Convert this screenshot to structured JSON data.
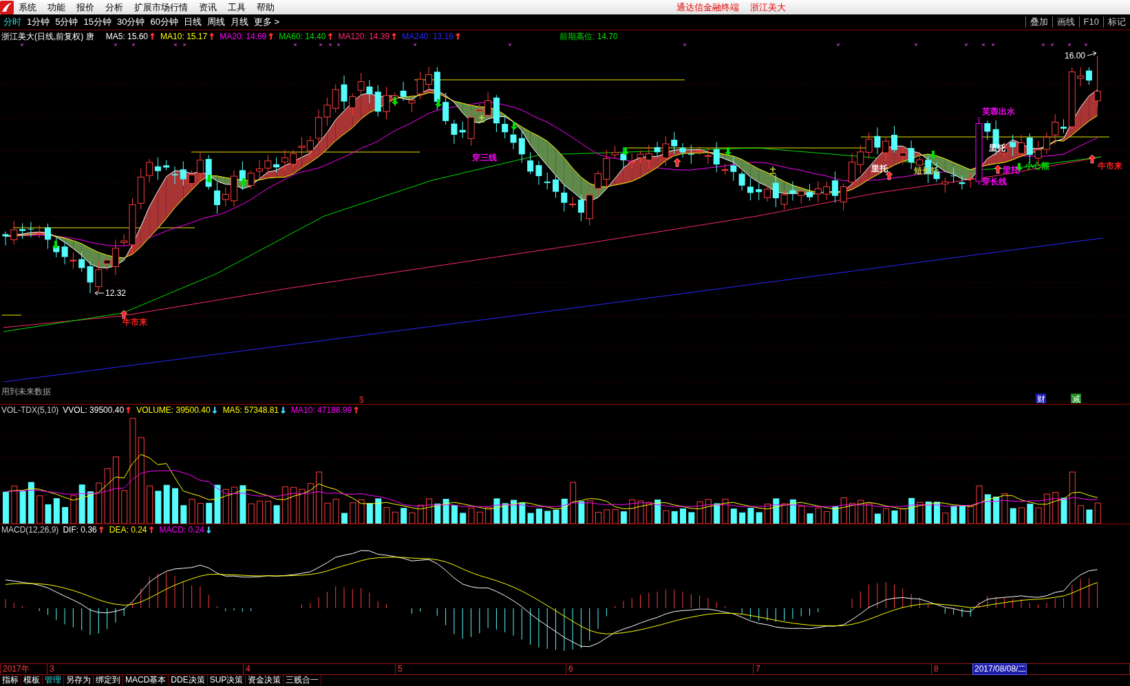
{
  "menu_bar": {
    "items": [
      "系统",
      "功能",
      "报价",
      "分析",
      "扩展市场行情",
      "资讯",
      "工具",
      "帮助"
    ],
    "titles": [
      "通达信金融终端",
      "浙江美大"
    ]
  },
  "period_bar": {
    "tabs": [
      {
        "label": "分时",
        "highlighted": true
      },
      {
        "label": "1分钟",
        "highlighted": false
      },
      {
        "label": "5分钟",
        "highlighted": false
      },
      {
        "label": "15分钟",
        "highlighted": false
      },
      {
        "label": "30分钟",
        "highlighted": false
      },
      {
        "label": "60分钟",
        "highlighted": false
      },
      {
        "label": "日线",
        "highlighted": false
      },
      {
        "label": "周线",
        "highlighted": false
      },
      {
        "label": "月线",
        "highlighted": false
      },
      {
        "label": "更多 >",
        "highlighted": false
      }
    ],
    "tools": [
      "叠加",
      "画线",
      "F10",
      "标记"
    ]
  },
  "chart_header": {
    "title": "浙江美大(日线,前复权) 唐",
    "indicators": [
      {
        "label": "MA5: 15.60",
        "color": "#ffffff",
        "arrow": {
          "text": "↑",
          "color": "#ff3030"
        }
      },
      {
        "label": "MA10: 15.17",
        "color": "#ffff00",
        "arrow": {
          "text": "↑",
          "color": "#ff3030"
        }
      },
      {
        "label": "MA20: 14.69",
        "color": "#ff00ff",
        "arrow": {
          "text": "↑",
          "color": "#ff3030"
        }
      },
      {
        "label": "MA60: 14.40",
        "color": "#00e000",
        "arrow": {
          "text": "↑",
          "color": "#ff3030"
        }
      },
      {
        "label": "MA120: 14.39",
        "color": "#ff2a6a",
        "arrow": {
          "text": "↑",
          "color": "#ff3030"
        }
      },
      {
        "label": "MA240: 13.16",
        "color": "#2828ff",
        "arrow": {
          "text": "↑",
          "color": "#ff3030"
        }
      }
    ],
    "previous_high": "前期高位: 14.70"
  },
  "price_chart": {
    "low_label": "12.32",
    "high_label": "16.00",
    "signals": [
      {
        "text": "牛市来",
        "color": "#ff2020"
      },
      {
        "text": "穿三线",
        "color": "#ff00ff"
      },
      {
        "text": "芙蓉出水",
        "color": "#ff00ff"
      },
      {
        "text": "里托",
        "color": "#ffffff"
      },
      {
        "text": "短长托",
        "color": "#c8c850"
      },
      {
        "text": "里托",
        "color": "#ffffff"
      },
      {
        "text": "穿长线",
        "color": "#ff00ff"
      },
      {
        "text": "里托",
        "color": "#ff00ff"
      },
      {
        "text": "小心熊",
        "color": "#00e000"
      },
      {
        "text": "牛市来",
        "color": "#ff2020"
      }
    ],
    "note": "用到未来数据",
    "future_mark": "$",
    "tags": [
      {
        "text": "财",
        "color": "#1c1cb4"
      },
      {
        "text": "减",
        "color": "#1e8c1e"
      }
    ]
  },
  "volume_panel": {
    "title": "VOL-TDX(5,10)",
    "readouts": [
      {
        "label": "VVOL: 39500.40",
        "color": "#ffffff",
        "arrow": {
          "text": "↑",
          "color": "#ff3030"
        }
      },
      {
        "label": "VOLUME: 39500.40",
        "color": "#ffff00",
        "arrow": {
          "text": "↓",
          "color": "#40d8ff"
        }
      },
      {
        "label": "MA5: 57348.81",
        "color": "#ffff00",
        "arrow": {
          "text": "↓",
          "color": "#40d8ff"
        }
      },
      {
        "label": "MA10: 47188.99",
        "color": "#ff00ff",
        "arrow": {
          "text": "↑",
          "color": "#ff3030"
        }
      }
    ]
  },
  "macd_panel": {
    "title": "MACD(12,26,9)",
    "readouts": [
      {
        "label": "DIF: 0.36",
        "color": "#ffffff",
        "arrow": {
          "text": "↑",
          "color": "#ff3030"
        }
      },
      {
        "label": "DEA: 0.24",
        "color": "#ffff00",
        "arrow": {
          "text": "↑",
          "color": "#ff3030"
        }
      },
      {
        "label": "MACD: 0.24",
        "color": "#ff00ff",
        "arrow": {
          "text": "↓",
          "color": "#40d8ff"
        }
      }
    ]
  },
  "date_axis": {
    "labels": [
      "2017年",
      "3",
      "4",
      "5",
      "6",
      "7",
      "8"
    ],
    "cursor_date": "2017/08/08/二"
  },
  "bottom_tabs": [
    {
      "label": "指标",
      "selected": false
    },
    {
      "label": "模板",
      "selected": false
    },
    {
      "label": "管理",
      "selected": true
    },
    {
      "label": "另存为",
      "selected": false
    },
    {
      "label": "绑定到",
      "selected": false
    },
    {
      "label": "MACD基本",
      "selected": false
    },
    {
      "label": "DDE决策",
      "selected": false
    },
    {
      "label": "SUP决策",
      "selected": false
    },
    {
      "label": "资金决策",
      "selected": false
    },
    {
      "label": "三贱合一",
      "selected": false
    }
  ]
}
